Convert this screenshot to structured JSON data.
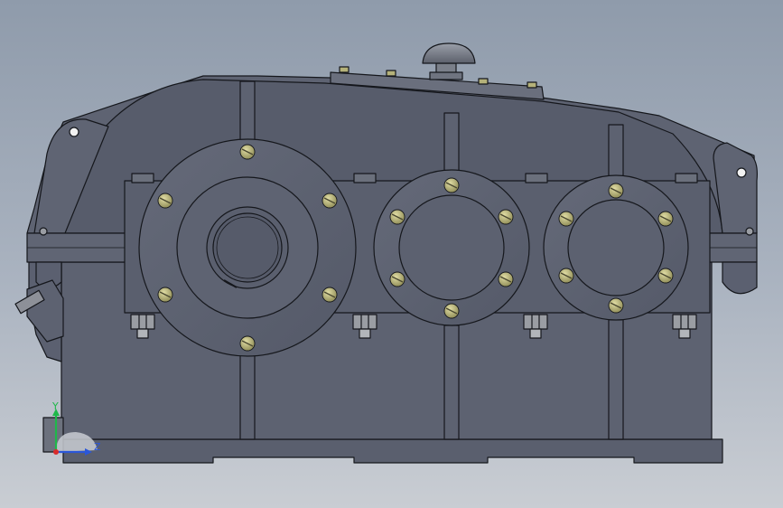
{
  "viewport": {
    "background_top": "#8f9bab",
    "background_bottom": "#c9cdd3"
  },
  "model": {
    "body_color": "#5d6271",
    "body_dark": "#4f5463",
    "edge_color": "#15171c",
    "bolt_color": "#b5b27a",
    "nut_color": "#9a9da3"
  },
  "triad": {
    "y_label": "Y",
    "z_label": "Z",
    "y_color": "#1fb84a",
    "z_color": "#2b57d9",
    "x_color": "#d92b2b"
  }
}
